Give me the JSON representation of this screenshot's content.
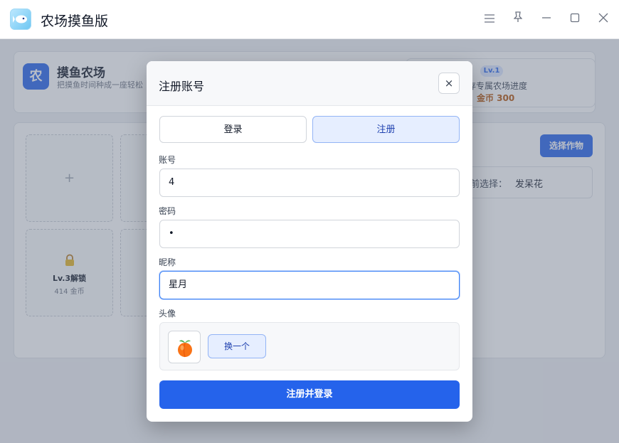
{
  "window": {
    "title": "农场摸鱼版",
    "controls": [
      "menu-icon",
      "pin-icon",
      "minimize-icon",
      "maximize-icon",
      "close-icon"
    ]
  },
  "background": {
    "brand_badge": "农",
    "brand_title": "摸鱼农场",
    "brand_subtitle": "把摸鱼时间种成一座轻松",
    "level_badge": "Lv.1",
    "save_text": "存专属农场进度",
    "gold_text": "金币 300",
    "plots": [
      {
        "type": "empty",
        "symbol": "+"
      },
      {
        "type": "locked",
        "level": "Lv.3解锁",
        "cost": "414 金币"
      }
    ],
    "select_crop_button": "选择作物",
    "current_label": "前选择：",
    "current_value": "发呆花"
  },
  "modal": {
    "title": "注册账号",
    "close_symbol": "×",
    "tabs": [
      {
        "label": "登录",
        "active": false
      },
      {
        "label": "注册",
        "active": true
      }
    ],
    "account": {
      "label": "账号",
      "value": "4"
    },
    "password": {
      "label": "密码",
      "value": "•"
    },
    "nickname": {
      "label": "昵称",
      "value": "星月"
    },
    "avatar": {
      "label": "头像",
      "icon": "peach-icon",
      "swap_button": "换一个"
    },
    "submit_button": "注册并登录"
  },
  "colors": {
    "primary": "#2563eb",
    "tab_active_bg": "#e6eeff",
    "gold": "#b45309"
  }
}
